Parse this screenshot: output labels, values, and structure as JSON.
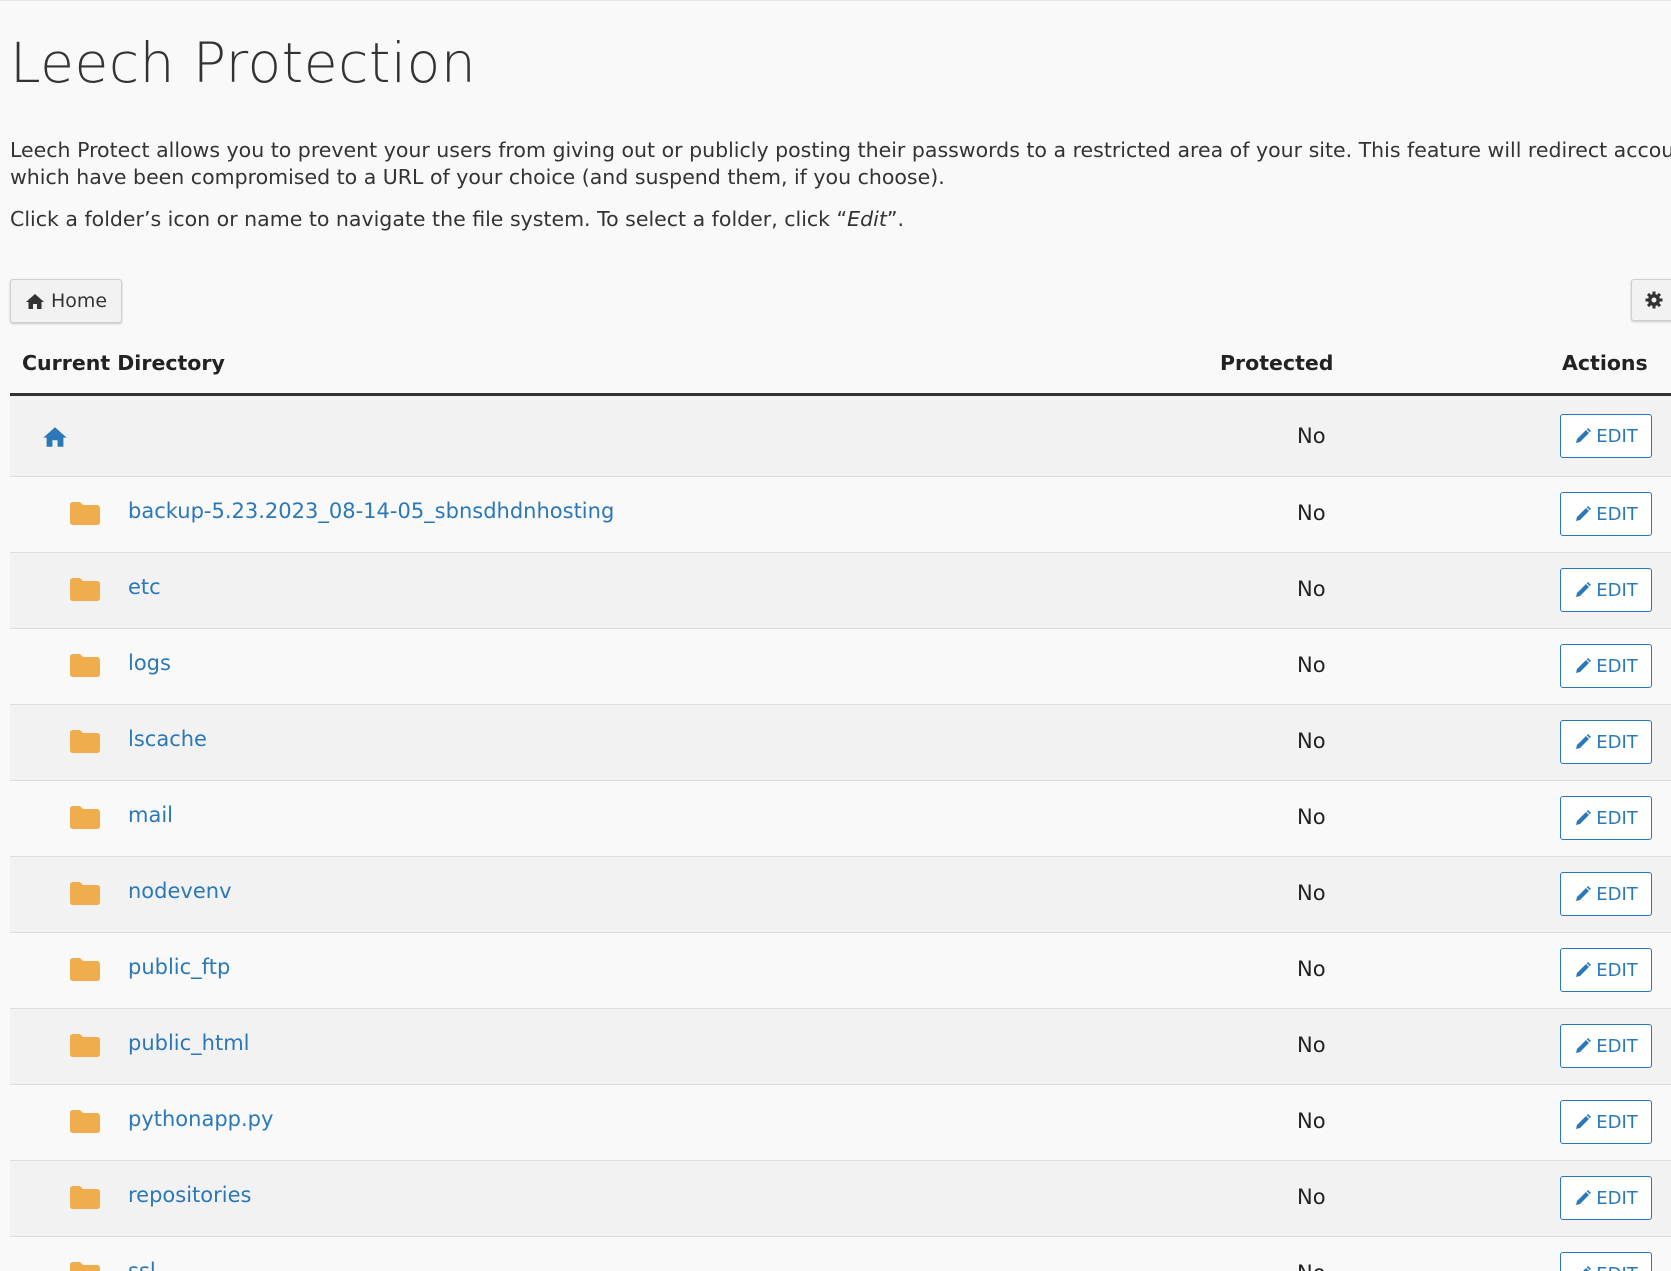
{
  "page": {
    "title": "Leech Protection",
    "description": "Leech Protect allows you to prevent your users from giving out or publicly posting their passwords to a restricted area of your site. This feature will redirect accounts which have been compromised to a URL of your choice (and suspend them, if you choose).",
    "hint_before": "Click a folder’s icon or name to navigate the file system. To select a folder, click “",
    "hint_em": "Edit",
    "hint_after": "”."
  },
  "toolbar": {
    "home_label": "Home",
    "home_icon": "home-icon",
    "settings_icon": "gear-icon"
  },
  "table": {
    "headers": {
      "directory": "Current Directory",
      "protected": "Protected",
      "actions": "Actions"
    },
    "edit_label": "EDIT",
    "root": {
      "icon": "home-icon",
      "protected": "No"
    },
    "rows": [
      {
        "name": "backup-5.23.2023_08-14-05_sbnsdhdnhosting",
        "protected": "No"
      },
      {
        "name": "etc",
        "protected": "No"
      },
      {
        "name": "logs",
        "protected": "No"
      },
      {
        "name": "lscache",
        "protected": "No"
      },
      {
        "name": "mail",
        "protected": "No"
      },
      {
        "name": "nodevenv",
        "protected": "No"
      },
      {
        "name": "public_ftp",
        "protected": "No"
      },
      {
        "name": "public_html",
        "protected": "No"
      },
      {
        "name": "pythonapp.py",
        "protected": "No"
      },
      {
        "name": "repositories",
        "protected": "No"
      },
      {
        "name": "ssl",
        "protected": "No"
      }
    ]
  },
  "colors": {
    "link": "#2b78b8",
    "folder": "#f0ad4e",
    "background": "#f9f9f9"
  }
}
